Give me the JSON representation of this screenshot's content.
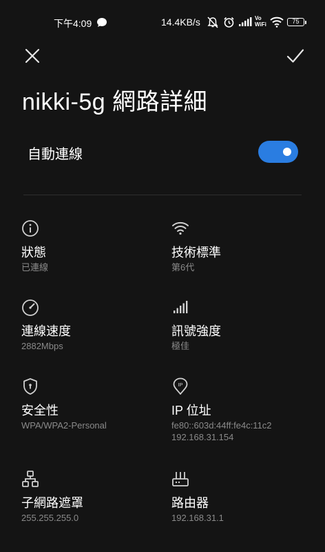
{
  "status_bar": {
    "time": "下午4:09",
    "net_speed": "14.4KB/s",
    "vowifi_top": "Vo",
    "vowifi_bottom": "WiFi",
    "battery": "75"
  },
  "page": {
    "title": "nikki-5g 網路詳細"
  },
  "auto_connect": {
    "label": "自動連線",
    "enabled": true
  },
  "details": [
    {
      "icon": "info-icon",
      "label": "狀態",
      "value": "已連線"
    },
    {
      "icon": "wifi-icon",
      "label": "技術標準",
      "value": "第6代"
    },
    {
      "icon": "speedometer-icon",
      "label": "連線速度",
      "value": "2882Mbps"
    },
    {
      "icon": "signal-strength-icon",
      "label": "訊號強度",
      "value": "極佳"
    },
    {
      "icon": "shield-icon",
      "label": "安全性",
      "value": "WPA/WPA2-Personal"
    },
    {
      "icon": "ip-pin-icon",
      "label": "IP 位址",
      "value": "fe80::603d:44ff:fe4c:11c2",
      "value2": "192.168.31.154"
    },
    {
      "icon": "subnet-icon",
      "label": "子網路遮罩",
      "value": "255.255.255.0"
    },
    {
      "icon": "router-icon",
      "label": "路由器",
      "value": "192.168.31.1"
    }
  ],
  "colors": {
    "background": "#141414",
    "accent": "#2a7de1",
    "secondary_text": "#8a8a8a"
  }
}
